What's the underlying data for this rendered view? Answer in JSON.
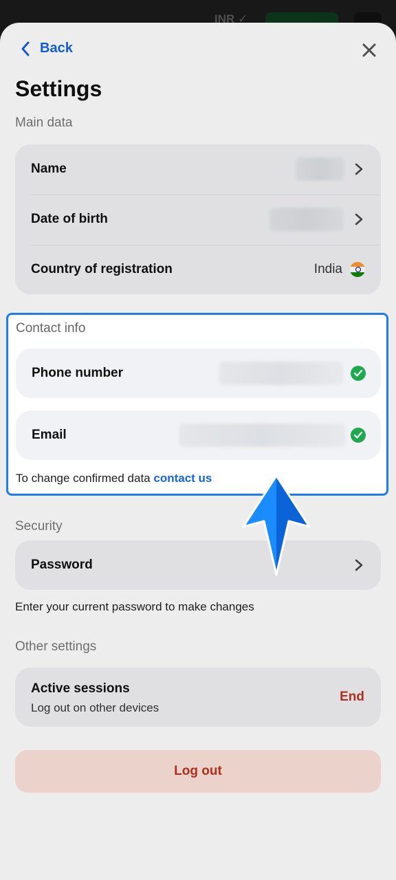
{
  "background_app": {
    "currency": "INR ✓"
  },
  "header": {
    "back_label": "Back"
  },
  "title": "Settings",
  "main_data": {
    "section_label": "Main data",
    "rows": [
      {
        "label": "Name",
        "value": "",
        "action": "chevron-right-icon"
      },
      {
        "label": "Date of birth",
        "value": "",
        "action": "chevron-right-icon"
      },
      {
        "label": "Country of registration",
        "value": "India",
        "action": "india-flag-icon"
      }
    ]
  },
  "contact_info": {
    "section_label": "Contact info",
    "rows": [
      {
        "label": "Phone number",
        "status": "verified"
      },
      {
        "label": "Email",
        "status": "verified"
      }
    ],
    "note_text": "To change confirmed data",
    "note_link": "contact us"
  },
  "security": {
    "section_label": "Security",
    "password_label": "Password",
    "note_text": "Enter your current password to make changes"
  },
  "other_settings": {
    "section_label": "Other settings",
    "active_sessions_label": "Active sessions",
    "active_sessions_sub": "Log out on other devices",
    "end_label": "End"
  },
  "logout_label": "Log out",
  "colors": {
    "accent": "#1565e0",
    "danger": "#c0321e",
    "verified": "#1fa84f",
    "card_bg": "#f1f2f5",
    "highlight_border": "#1e7cf0"
  }
}
